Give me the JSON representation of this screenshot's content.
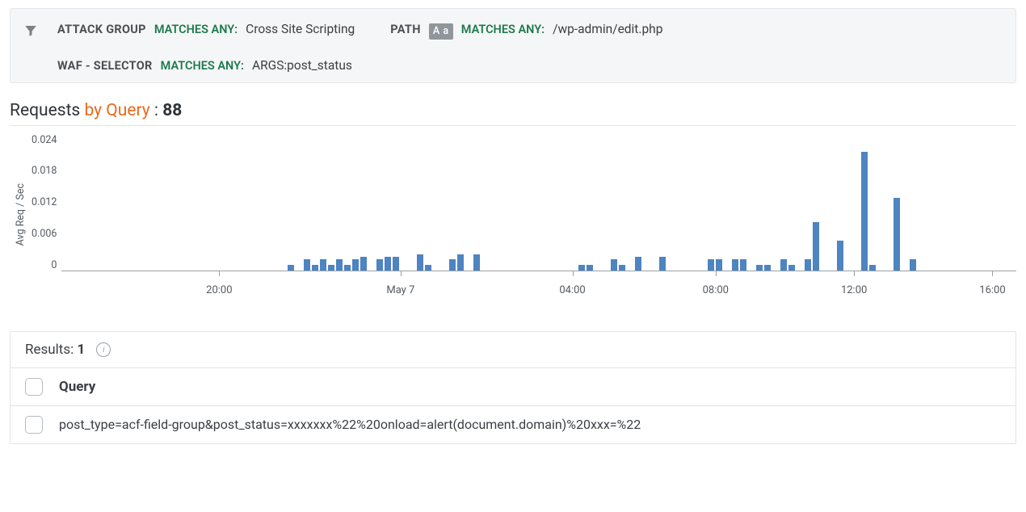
{
  "filters": {
    "attack_group": {
      "field": "ATTACK GROUP",
      "op": "MATCHES ANY:",
      "value": "Cross Site Scripting"
    },
    "path": {
      "field": "PATH",
      "case_badge": "A a",
      "op": "MATCHES ANY:",
      "value": "/wp-admin/edit.php"
    },
    "waf_selector": {
      "field": "WAF - SELECTOR",
      "op": "MATCHES ANY:",
      "value": "ARGS:post_status"
    }
  },
  "section": {
    "prefix": "Requests ",
    "byquery": "by Query",
    "sep": " : ",
    "count": "88"
  },
  "results": {
    "label": "Results: ",
    "count": "1",
    "column_header": "Query",
    "rows": [
      "post_type=acf-field-group&post_status=xxxxxxx%22%20onload=alert(document.domain)%20xxx=%22"
    ]
  },
  "chart_data": {
    "type": "bar",
    "ylabel": "Avg Req / Sec",
    "ylim": [
      0,
      0.024
    ],
    "yticks": [
      0.024,
      0.018,
      0.012,
      0.006,
      0
    ],
    "xticks_labels": [
      "20:00",
      "May 7",
      "04:00",
      "08:00",
      "12:00",
      "16:00"
    ],
    "xticks_pos_pct": [
      16.5,
      35.5,
      53.5,
      68.5,
      83.0,
      97.5
    ],
    "values": [
      0,
      0,
      0,
      0,
      0,
      0,
      0,
      0,
      0,
      0,
      0,
      0,
      0,
      0,
      0,
      0,
      0,
      0,
      0,
      0,
      0,
      0,
      0,
      0,
      0,
      0,
      0,
      0,
      0.001,
      0,
      0.002,
      0.001,
      0.002,
      0.001,
      0.002,
      0.001,
      0.002,
      0.0025,
      0,
      0.002,
      0.0025,
      0.0025,
      0,
      0,
      0.003,
      0.001,
      0,
      0,
      0.002,
      0.003,
      0,
      0.003,
      0,
      0,
      0,
      0,
      0,
      0,
      0,
      0,
      0,
      0,
      0,
      0,
      0.001,
      0.001,
      0,
      0,
      0.002,
      0.001,
      0,
      0.0025,
      0,
      0,
      0.0025,
      0,
      0,
      0,
      0,
      0,
      0.002,
      0.002,
      0,
      0.002,
      0.002,
      0,
      0.001,
      0.001,
      0,
      0.002,
      0.001,
      0,
      0.002,
      0.009,
      0,
      0,
      0.0055,
      0,
      0,
      0.022,
      0.001,
      0,
      0,
      0.0135,
      0,
      0.002,
      0,
      0
    ]
  }
}
